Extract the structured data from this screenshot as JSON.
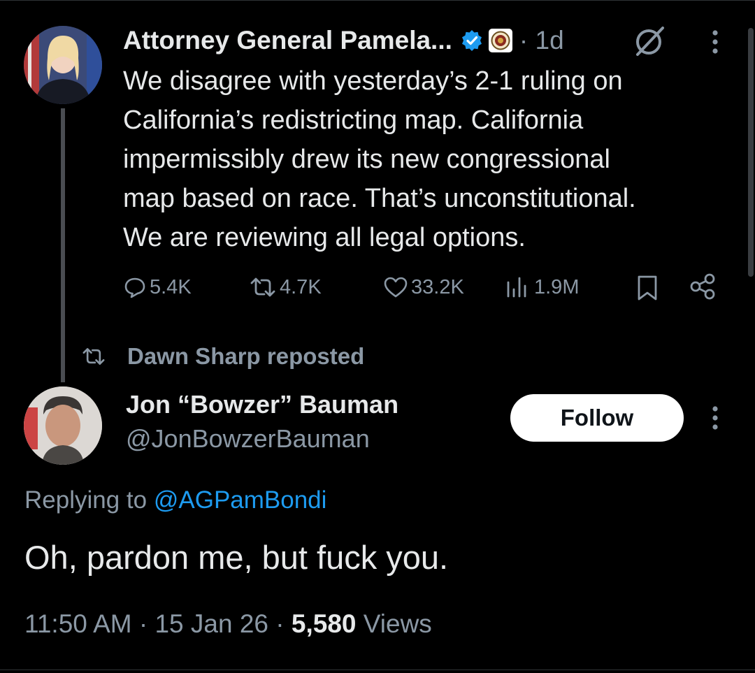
{
  "parent_tweet": {
    "author_name": "Attorney General Pamela...",
    "time_ago": "1d",
    "text_lines": [
      "We disagree with yesterday’s 2-1 ruling on",
      "California’s redistricting map.  California",
      "impermissibly drew its new congressional",
      "map based on race.  That’s unconstitutional.",
      "We are reviewing all legal options."
    ],
    "metrics": {
      "replies": "5.4K",
      "reposts": "4.7K",
      "likes": "33.2K",
      "views": "1.9M"
    }
  },
  "repost_banner": {
    "text": "Dawn Sharp reposted"
  },
  "reply_tweet": {
    "author_name": "Jon “Bowzer” Bauman",
    "handle": "@JonBowzerBauman",
    "follow_label": "Follow",
    "replying_prefix": "Replying to",
    "replying_handle": "@AGPamBondi",
    "text": "Oh, pardon me, but fuck you.",
    "time": "11:50 AM",
    "date": "15 Jan 26",
    "view_count": "5,580",
    "views_label": "Views"
  },
  "colors": {
    "background": "#000000",
    "text": "#e7e9ea",
    "muted": "#8b98a5",
    "link": "#1d9bf0",
    "verified": "#1d9bf0"
  },
  "icons": [
    "verified-badge-icon",
    "doj-seal-icon",
    "grok-icon",
    "more-icon",
    "reply-icon",
    "repost-icon",
    "like-icon",
    "views-icon",
    "bookmark-icon",
    "share-icon"
  ]
}
